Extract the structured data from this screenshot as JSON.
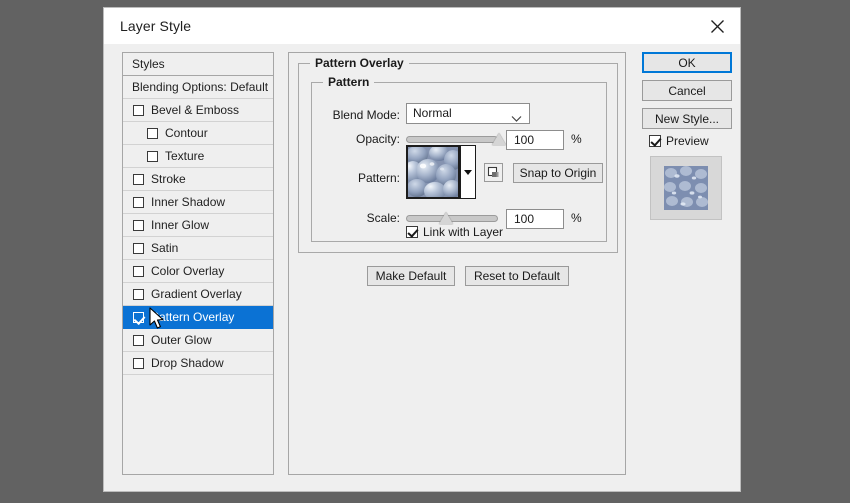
{
  "window": {
    "title": "Layer Style",
    "close_icon": "close-icon"
  },
  "styles_panel": {
    "header": "Styles",
    "items": [
      {
        "label": "Blending Options: Default",
        "type": "plain",
        "checked": false,
        "indent": false,
        "selected": false
      },
      {
        "label": "Bevel & Emboss",
        "type": "check",
        "checked": false,
        "indent": false,
        "selected": false
      },
      {
        "label": "Contour",
        "type": "check",
        "checked": false,
        "indent": true,
        "selected": false
      },
      {
        "label": "Texture",
        "type": "check",
        "checked": false,
        "indent": true,
        "selected": false
      },
      {
        "label": "Stroke",
        "type": "check",
        "checked": false,
        "indent": false,
        "selected": false
      },
      {
        "label": "Inner Shadow",
        "type": "check",
        "checked": false,
        "indent": false,
        "selected": false
      },
      {
        "label": "Inner Glow",
        "type": "check",
        "checked": false,
        "indent": false,
        "selected": false
      },
      {
        "label": "Satin",
        "type": "check",
        "checked": false,
        "indent": false,
        "selected": false
      },
      {
        "label": "Color Overlay",
        "type": "check",
        "checked": false,
        "indent": false,
        "selected": false
      },
      {
        "label": "Gradient Overlay",
        "type": "check",
        "checked": false,
        "indent": false,
        "selected": false
      },
      {
        "label": "Pattern Overlay",
        "type": "check",
        "checked": true,
        "indent": false,
        "selected": true
      },
      {
        "label": "Outer Glow",
        "type": "check",
        "checked": false,
        "indent": false,
        "selected": false
      },
      {
        "label": "Drop Shadow",
        "type": "check",
        "checked": false,
        "indent": false,
        "selected": false
      }
    ]
  },
  "pattern_overlay": {
    "group_title": "Pattern Overlay",
    "inner_group_title": "Pattern",
    "blend_mode": {
      "label": "Blend Mode:",
      "value": "Normal",
      "chevron_icon": "chevron-down-icon"
    },
    "opacity": {
      "label": "Opacity:",
      "value": "100",
      "unit": "%",
      "slider_percent": 100
    },
    "pattern": {
      "label": "Pattern:",
      "dropdown_icon": "triangle-down-icon",
      "new_pattern_icon": "new-pattern-icon",
      "snap_button": "Snap to Origin"
    },
    "scale": {
      "label": "Scale:",
      "value": "100",
      "unit": "%",
      "slider_percent": 42
    },
    "link_with_layer": {
      "label": "Link with Layer",
      "checked": true
    },
    "make_default": "Make Default",
    "reset_to_default": "Reset to Default"
  },
  "actions": {
    "ok": "OK",
    "cancel": "Cancel",
    "new_style": "New Style...",
    "preview": {
      "label": "Preview",
      "checked": true
    }
  },
  "colors": {
    "accent": "#0b72d4",
    "focus": "#0078d7",
    "dialog_bg": "#efefef",
    "desktop_bg": "#626262",
    "pattern_base": "#8c9cb8"
  }
}
